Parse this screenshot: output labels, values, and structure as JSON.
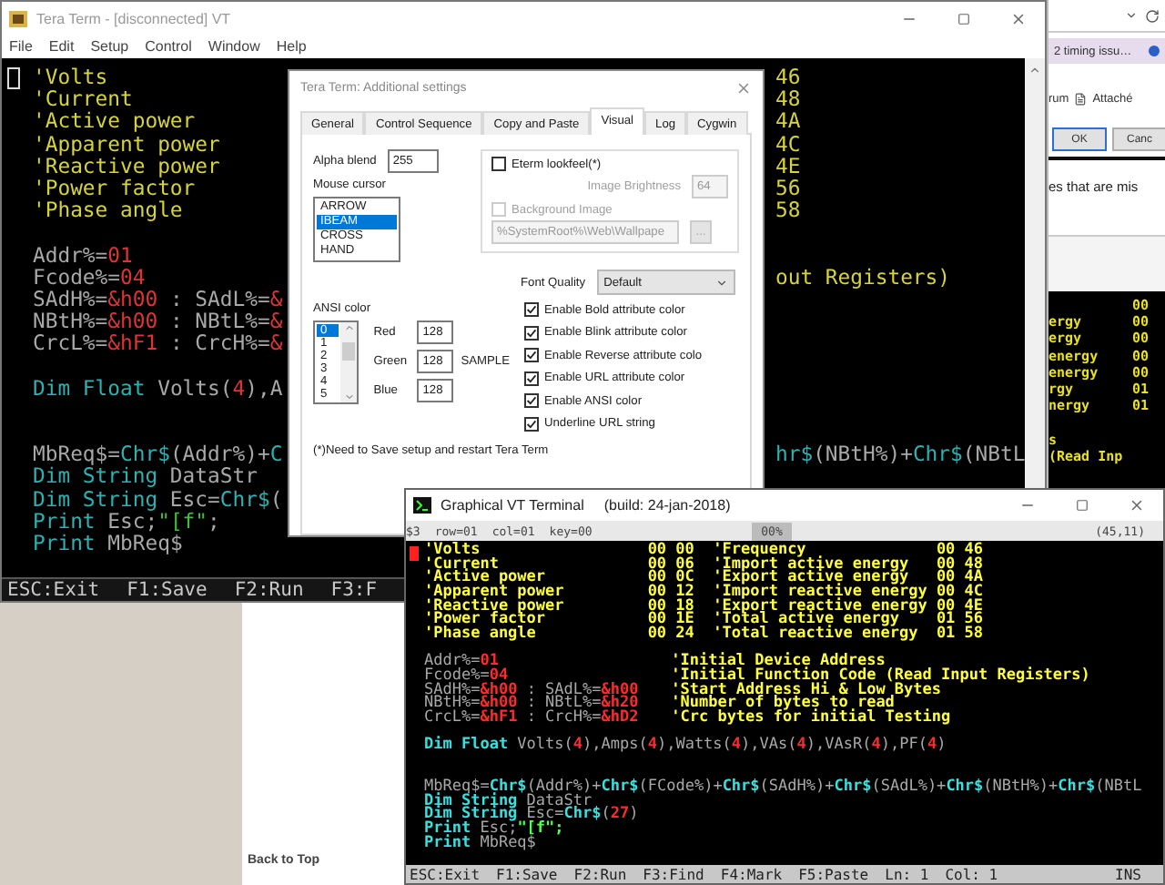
{
  "browser": {
    "tab": "2 timing issu…",
    "link": "rum",
    "attachment": "Attaché",
    "buttons": [
      {
        "label": "OK",
        "focused": true
      },
      {
        "label": "Canc",
        "focused": false
      }
    ],
    "snippet_text": "es that are mis",
    "terminal_lines": [
      {
        "kind": "row",
        "value": "00"
      },
      {
        "kind": "row",
        "label": "ergy",
        "value": "00"
      },
      {
        "kind": "row",
        "label": "ergy",
        "value": "00"
      },
      {
        "kind": "row",
        "label": "energy",
        "value": "00"
      },
      {
        "kind": "row",
        "label": "energy",
        "value": "00"
      },
      {
        "kind": "row",
        "label": "rgy",
        "value": "01"
      },
      {
        "kind": "row",
        "label": "nergy",
        "value": "01"
      },
      {
        "kind": "blank"
      },
      {
        "kind": "row",
        "label": "s"
      },
      {
        "kind": "row",
        "label": "(Read Inp"
      }
    ],
    "back_to_top": "Back to Top"
  },
  "teraterm": {
    "title": "Tera Term - [disconnected] VT",
    "menu": [
      "File",
      "Edit",
      "Setup",
      "Control",
      "Window",
      "Help"
    ],
    "lines": [
      {
        "kind": "split",
        "cells": [
          [
            {
              "kind": "comment",
              "text": "'Volts"
            }
          ],
          [
            {
              "kind": "value",
              "text": "46"
            }
          ]
        ]
      },
      {
        "kind": "split",
        "cells": [
          [
            {
              "kind": "comment",
              "text": "'Current"
            }
          ],
          [
            {
              "kind": "value",
              "text": "48"
            }
          ]
        ]
      },
      {
        "kind": "split",
        "cells": [
          [
            {
              "kind": "comment",
              "text": "'Active power"
            }
          ],
          [
            {
              "kind": "value",
              "text": "4A"
            }
          ]
        ]
      },
      {
        "kind": "split",
        "cells": [
          [
            {
              "kind": "comment",
              "text": "'Apparent power"
            }
          ],
          [
            {
              "kind": "value",
              "text": "4C"
            }
          ]
        ]
      },
      {
        "kind": "split",
        "cells": [
          [
            {
              "kind": "comment",
              "text": "'Reactive power"
            }
          ],
          [
            {
              "kind": "value",
              "text": "4E"
            }
          ]
        ]
      },
      {
        "kind": "split",
        "cells": [
          [
            {
              "kind": "comment",
              "text": "'Power factor"
            }
          ],
          [
            {
              "kind": "value",
              "text": "56"
            }
          ]
        ]
      },
      {
        "kind": "split",
        "cells": [
          [
            {
              "kind": "comment",
              "text": "'Phase angle"
            }
          ],
          [
            {
              "kind": "value",
              "text": "58"
            }
          ]
        ]
      },
      {
        "kind": "blank"
      },
      {
        "kind": "code",
        "cells": [
          [
            {
              "kind": "variable",
              "text": "Addr%="
            },
            {
              "kind": "number",
              "text": "01"
            }
          ]
        ]
      },
      {
        "kind": "split",
        "cells": [
          [
            {
              "kind": "variable",
              "text": "Fcode%="
            },
            {
              "kind": "number",
              "text": "04"
            }
          ],
          [
            {
              "kind": "comment",
              "text": "out Registers)"
            }
          ]
        ]
      },
      {
        "kind": "code",
        "cells": [
          [
            {
              "kind": "variable",
              "text": "SAdH%="
            },
            {
              "kind": "number",
              "text": "&h00"
            },
            {
              "kind": "variable",
              "text": " : SAdL%="
            },
            {
              "kind": "number",
              "text": "&"
            }
          ]
        ]
      },
      {
        "kind": "code",
        "cells": [
          [
            {
              "kind": "variable",
              "text": "NBtH%="
            },
            {
              "kind": "number",
              "text": "&h00"
            },
            {
              "kind": "variable",
              "text": " : NBtL%="
            },
            {
              "kind": "number",
              "text": "&"
            }
          ]
        ]
      },
      {
        "kind": "code",
        "cells": [
          [
            {
              "kind": "variable",
              "text": "CrcL%="
            },
            {
              "kind": "number",
              "text": "&hF1"
            },
            {
              "kind": "variable",
              "text": " : CrcH%="
            },
            {
              "kind": "number",
              "text": "&"
            }
          ]
        ]
      },
      {
        "kind": "blank"
      },
      {
        "kind": "code",
        "cells": [
          [
            {
              "kind": "keyword",
              "text": "Dim Float"
            },
            {
              "kind": "variable",
              "text": " Volts("
            },
            {
              "kind": "number",
              "text": "4"
            },
            {
              "kind": "variable",
              "text": "),A"
            }
          ]
        ]
      },
      {
        "kind": "blank"
      },
      {
        "kind": "blank"
      },
      {
        "kind": "split",
        "cells": [
          [
            {
              "kind": "variable",
              "text": "MbReq$="
            },
            {
              "kind": "keyword",
              "text": "Chr$"
            },
            {
              "kind": "variable",
              "text": "(Addr%)+"
            },
            {
              "kind": "keyword",
              "text": "C"
            }
          ],
          [
            {
              "kind": "keyword",
              "text": "hr$"
            },
            {
              "kind": "variable",
              "text": "(NBtH%)+"
            },
            {
              "kind": "keyword",
              "text": "Chr$"
            },
            {
              "kind": "variable",
              "text": "(NBtL"
            }
          ]
        ]
      },
      {
        "kind": "code",
        "cells": [
          [
            {
              "kind": "keyword",
              "text": "Dim String"
            },
            {
              "kind": "variable",
              "text": " DataStr"
            }
          ]
        ]
      },
      {
        "kind": "code",
        "cells": [
          [
            {
              "kind": "keyword",
              "text": "Dim String"
            },
            {
              "kind": "variable",
              "text": " Esc="
            },
            {
              "kind": "keyword",
              "text": "Chr$"
            },
            {
              "kind": "variable",
              "text": "("
            }
          ]
        ]
      },
      {
        "kind": "code",
        "cells": [
          [
            {
              "kind": "keyword",
              "text": "Print"
            },
            {
              "kind": "variable",
              "text": " Esc;"
            },
            {
              "kind": "string",
              "text": "\"[f\""
            },
            {
              "kind": "variable",
              "text": ";"
            }
          ]
        ]
      },
      {
        "kind": "code",
        "cells": [
          [
            {
              "kind": "keyword",
              "text": "Print"
            },
            {
              "kind": "variable",
              "text": " MbReq$"
            }
          ]
        ]
      }
    ],
    "status_bar": [
      "ESC:Exit",
      "F1:Save",
      "F2:Run",
      "F3:F"
    ]
  },
  "dialog": {
    "title": "Tera Term: Additional settings",
    "tabs": [
      {
        "label": "General",
        "selected": false
      },
      {
        "label": "Control Sequence",
        "selected": false
      },
      {
        "label": "Copy and Paste",
        "selected": false
      },
      {
        "label": "Visual",
        "selected": true
      },
      {
        "label": "Log",
        "selected": false
      },
      {
        "label": "Cygwin",
        "selected": false
      }
    ],
    "alpha_blend": {
      "label": "Alpha blend",
      "value": "255"
    },
    "mouse_cursor": {
      "label": "Mouse cursor",
      "items": [
        {
          "label": "ARROW",
          "selected": false
        },
        {
          "label": "IBEAM",
          "selected": true
        },
        {
          "label": "CROSS",
          "selected": false
        },
        {
          "label": "HAND",
          "selected": false
        }
      ]
    },
    "eterm_lookfeel": {
      "label": "Eterm lookfeel(*)",
      "checked": false
    },
    "image_brightness": {
      "label": "Image Brightness",
      "value": "64",
      "disabled": true
    },
    "background_image": {
      "label": "Background Image",
      "checked": false,
      "disabled": true
    },
    "wallpaper_path": {
      "value": "%SystemRoot%\\Web\\Wallpape",
      "disabled": true
    },
    "browse_button": {
      "label": "...",
      "disabled": true
    },
    "font_quality": {
      "label": "Font Quality",
      "value": "Default"
    },
    "ansi_color": {
      "label": "ANSI color",
      "items": [
        {
          "label": "0",
          "selected": true
        },
        {
          "label": "1",
          "selected": false
        },
        {
          "label": "2",
          "selected": false
        },
        {
          "label": "3",
          "selected": false
        },
        {
          "label": "4",
          "selected": false
        },
        {
          "label": "5",
          "selected": false
        }
      ],
      "channels": [
        {
          "label": "Red",
          "value": "128"
        },
        {
          "label": "Green",
          "value": "128"
        },
        {
          "label": "Blue",
          "value": "128"
        }
      ],
      "sample": "SAMPLE"
    },
    "options": [
      {
        "label": "Enable Bold attribute color",
        "checked": true
      },
      {
        "label": "Enable Blink attribute color",
        "checked": true
      },
      {
        "label": "Enable Reverse attribute colo",
        "checked": true
      },
      {
        "label": "Enable URL attribute color",
        "checked": true
      },
      {
        "label": "Enable ANSI color",
        "checked": true
      },
      {
        "label": "Underline URL string",
        "checked": true
      }
    ],
    "note": "(*)Need to Save setup and restart Tera Term"
  },
  "gvt": {
    "title": "Graphical VT Terminal",
    "build": "(build: 24-jan-2018)",
    "info_bar": {
      "items": [
        "$3",
        "row=01",
        "col=01",
        "key=00"
      ],
      "progress": "00%",
      "position": "(45,11)"
    },
    "lines": [
      {
        "kind": "register",
        "cells": [
          [
            {
              "kind": "comment",
              "text": "'Volts"
            }
          ],
          [
            {
              "kind": "value",
              "text": "00 00"
            }
          ],
          [
            {
              "kind": "comment",
              "text": "'Frequency"
            }
          ],
          [
            {
              "kind": "value",
              "text": "00 46"
            }
          ]
        ]
      },
      {
        "kind": "register",
        "cells": [
          [
            {
              "kind": "comment",
              "text": "'Current"
            }
          ],
          [
            {
              "kind": "value",
              "text": "00 06"
            }
          ],
          [
            {
              "kind": "comment",
              "text": "'Import active energy"
            }
          ],
          [
            {
              "kind": "value",
              "text": "00 48"
            }
          ]
        ]
      },
      {
        "kind": "register",
        "cells": [
          [
            {
              "kind": "comment",
              "text": "'Active power"
            }
          ],
          [
            {
              "kind": "value",
              "text": "00 0C"
            }
          ],
          [
            {
              "kind": "comment",
              "text": "'Export active energy"
            }
          ],
          [
            {
              "kind": "value",
              "text": "00 4A"
            }
          ]
        ]
      },
      {
        "kind": "register",
        "cells": [
          [
            {
              "kind": "comment",
              "text": "'Apparent power"
            }
          ],
          [
            {
              "kind": "value",
              "text": "00 12"
            }
          ],
          [
            {
              "kind": "comment",
              "text": "'Import reactive energy"
            }
          ],
          [
            {
              "kind": "value",
              "text": "00 4C"
            }
          ]
        ]
      },
      {
        "kind": "register",
        "cells": [
          [
            {
              "kind": "comment",
              "text": "'Reactive power"
            }
          ],
          [
            {
              "kind": "value",
              "text": "00 18"
            }
          ],
          [
            {
              "kind": "comment",
              "text": "'Export reactive energy"
            }
          ],
          [
            {
              "kind": "value",
              "text": "00 4E"
            }
          ]
        ]
      },
      {
        "kind": "register",
        "cells": [
          [
            {
              "kind": "comment",
              "text": "'Power factor"
            }
          ],
          [
            {
              "kind": "value",
              "text": "00 1E"
            }
          ],
          [
            {
              "kind": "comment",
              "text": "'Total active energy"
            }
          ],
          [
            {
              "kind": "value",
              "text": "01 56"
            }
          ]
        ]
      },
      {
        "kind": "register",
        "cells": [
          [
            {
              "kind": "comment",
              "text": "'Phase angle"
            }
          ],
          [
            {
              "kind": "value",
              "text": "00 24"
            }
          ],
          [
            {
              "kind": "comment",
              "text": "'Total reactive energy"
            }
          ],
          [
            {
              "kind": "value",
              "text": "01 58"
            }
          ]
        ]
      },
      {
        "kind": "blank"
      },
      {
        "kind": "assign",
        "cells": [
          [
            {
              "kind": "variable",
              "text": "Addr%="
            },
            {
              "kind": "number",
              "text": "01"
            }
          ],
          [
            {
              "kind": "comment",
              "text": "'Initial Device Address"
            }
          ]
        ]
      },
      {
        "kind": "assign",
        "cells": [
          [
            {
              "kind": "variable",
              "text": "Fcode%="
            },
            {
              "kind": "number",
              "text": "04"
            }
          ],
          [
            {
              "kind": "comment",
              "text": "'Initial Function Code (Read Input Registers)"
            }
          ]
        ]
      },
      {
        "kind": "assign",
        "cells": [
          [
            {
              "kind": "variable",
              "text": "SAdH%="
            },
            {
              "kind": "number",
              "text": "&h00"
            },
            {
              "kind": "variable",
              "text": " : SAdL%="
            },
            {
              "kind": "number",
              "text": "&h00"
            }
          ],
          [
            {
              "kind": "comment",
              "text": "'Start Address Hi & Low Bytes"
            }
          ]
        ]
      },
      {
        "kind": "assign",
        "cells": [
          [
            {
              "kind": "variable",
              "text": "NBtH%="
            },
            {
              "kind": "number",
              "text": "&h00"
            },
            {
              "kind": "variable",
              "text": " : NBtL%="
            },
            {
              "kind": "number",
              "text": "&h20"
            }
          ],
          [
            {
              "kind": "comment",
              "text": "'Number of bytes to read"
            }
          ]
        ]
      },
      {
        "kind": "assign",
        "cells": [
          [
            {
              "kind": "variable",
              "text": "CrcL%="
            },
            {
              "kind": "number",
              "text": "&hF1"
            },
            {
              "kind": "variable",
              "text": " : CrcH%="
            },
            {
              "kind": "number",
              "text": "&hD2"
            }
          ],
          [
            {
              "kind": "comment",
              "text": "'Crc bytes for initial Testing"
            }
          ]
        ]
      },
      {
        "kind": "blank"
      },
      {
        "kind": "code",
        "cells": [
          [
            {
              "kind": "keyword",
              "text": "Dim Float"
            },
            {
              "kind": "variable",
              "text": " Volts("
            },
            {
              "kind": "number",
              "text": "4"
            },
            {
              "kind": "variable",
              "text": "),Amps("
            },
            {
              "kind": "number",
              "text": "4"
            },
            {
              "kind": "variable",
              "text": "),Watts("
            },
            {
              "kind": "number",
              "text": "4"
            },
            {
              "kind": "variable",
              "text": "),VAs("
            },
            {
              "kind": "number",
              "text": "4"
            },
            {
              "kind": "variable",
              "text": "),VAsR("
            },
            {
              "kind": "number",
              "text": "4"
            },
            {
              "kind": "variable",
              "text": "),PF("
            },
            {
              "kind": "number",
              "text": "4"
            },
            {
              "kind": "variable",
              "text": ")"
            }
          ]
        ]
      },
      {
        "kind": "blank"
      },
      {
        "kind": "blank"
      },
      {
        "kind": "code",
        "cells": [
          [
            {
              "kind": "variable",
              "text": "MbReq$="
            },
            {
              "kind": "keyword",
              "text": "Chr$"
            },
            {
              "kind": "variable",
              "text": "(Addr%)+"
            },
            {
              "kind": "keyword",
              "text": "Chr$"
            },
            {
              "kind": "variable",
              "text": "(FCode%)+"
            },
            {
              "kind": "keyword",
              "text": "Chr$"
            },
            {
              "kind": "variable",
              "text": "(SAdH%)+"
            },
            {
              "kind": "keyword",
              "text": "Chr$"
            },
            {
              "kind": "variable",
              "text": "(SAdL%)+"
            },
            {
              "kind": "keyword",
              "text": "Chr$"
            },
            {
              "kind": "variable",
              "text": "(NBtH%)+"
            },
            {
              "kind": "keyword",
              "text": "Chr$"
            },
            {
              "kind": "variable",
              "text": "(NBtL"
            }
          ]
        ]
      },
      {
        "kind": "code",
        "cells": [
          [
            {
              "kind": "keyword",
              "text": "Dim String"
            },
            {
              "kind": "variable",
              "text": " DataStr"
            }
          ]
        ]
      },
      {
        "kind": "code",
        "cells": [
          [
            {
              "kind": "keyword",
              "text": "Dim String"
            },
            {
              "kind": "variable",
              "text": " Esc="
            },
            {
              "kind": "keyword",
              "text": "Chr$"
            },
            {
              "kind": "variable",
              "text": "("
            },
            {
              "kind": "number",
              "text": "27"
            },
            {
              "kind": "variable",
              "text": ")"
            }
          ]
        ]
      },
      {
        "kind": "code",
        "cells": [
          [
            {
              "kind": "keyword",
              "text": "Print"
            },
            {
              "kind": "variable",
              "text": " Esc;"
            },
            {
              "kind": "string",
              "text": "\"[f\";"
            }
          ]
        ]
      },
      {
        "kind": "code",
        "cells": [
          [
            {
              "kind": "keyword",
              "text": "Print"
            },
            {
              "kind": "variable",
              "text": " MbReq$"
            }
          ]
        ]
      }
    ],
    "status_bar": {
      "keys": [
        "ESC:Exit",
        "F1:Save",
        "F2:Run",
        "F3:Find",
        "F4:Mark",
        "F5:Paste",
        "Ln: 1",
        "Col: 1"
      ],
      "mode": "INS"
    }
  }
}
